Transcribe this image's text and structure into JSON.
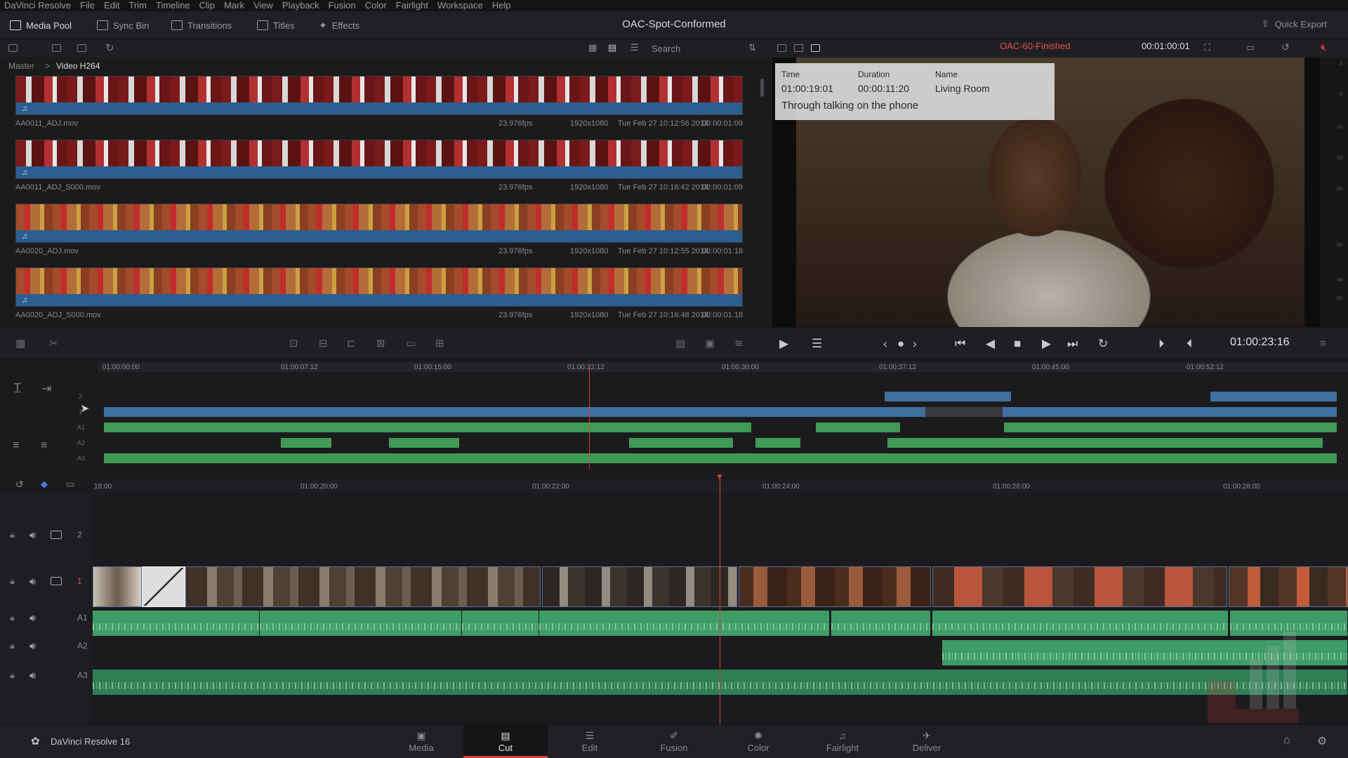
{
  "menu": [
    "DaVinci Resolve",
    "File",
    "Edit",
    "Trim",
    "Timeline",
    "Clip",
    "Mark",
    "View",
    "Playback",
    "Fusion",
    "Color",
    "Fairlight",
    "Workspace",
    "Help"
  ],
  "toolbar": {
    "media_pool": "Media Pool",
    "sync_bin": "Sync Bin",
    "transitions": "Transitions",
    "titles": "Titles",
    "effects": "Effects",
    "project_title": "OAC-Spot-Conformed",
    "quick_export": "Quick Export"
  },
  "mediapool": {
    "search_placeholder": "Search",
    "breadcrumb": {
      "root": "Master",
      "sep": ">",
      "current": "Video H264"
    },
    "clips": [
      {
        "name": "AA0011_ADJ.mov",
        "fps": "23.976fps",
        "res": "1920x1080",
        "date": "Tue Feb 27 10:12:56 2018",
        "duration": "00:00:01:09",
        "film": "red"
      },
      {
        "name": "AA0011_ADJ_S000.mov",
        "fps": "23.976fps",
        "res": "1920x1080",
        "date": "Tue Feb 27 10:16:42 2018",
        "duration": "00:00:01:09",
        "film": "red"
      },
      {
        "name": "AA0020_ADJ.mov",
        "fps": "23.976fps",
        "res": "1920x1080",
        "date": "Tue Feb 27 10:12:55 2018",
        "duration": "00:00:01:18",
        "film": "court"
      },
      {
        "name": "AA0020_ADJ_S000.mov",
        "fps": "23.976fps",
        "res": "1920x1080",
        "date": "Tue Feb 27 10:16:48 2018",
        "duration": "00:00:01:18",
        "film": "court"
      }
    ]
  },
  "viewer": {
    "clip_name": "OAC-60-Finished",
    "timecode_top": "00:01:00:01",
    "overlay": {
      "time_label": "Time",
      "time_value": "01:00:19:01",
      "duration_label": "Duration",
      "duration_value": "00:00:11:20",
      "name_label": "Name",
      "name_value": "Living Room",
      "description": "Through talking on the phone"
    },
    "meter_labels": [
      "0",
      "-5",
      "-10",
      "-15",
      "-20",
      "-30",
      "-40",
      "-50"
    ]
  },
  "transport": {
    "timecode": "01:00:23:16"
  },
  "upper_timeline": {
    "ruler": [
      "01:00:00:00",
      "01:00:07:12",
      "01:00:15:00",
      "01:00:22:12",
      "01:00:30:00",
      "01:00:37:12",
      "01:00:45:00",
      "01:00:52:12"
    ],
    "track_labels": [
      "2",
      "1",
      "A1",
      "A2",
      "A3"
    ]
  },
  "lower_timeline": {
    "ruler": [
      "18:00",
      "01:00:20:00",
      "01:00:22:00",
      "01:00:24:00",
      "01:00:26:00",
      "01:00:28:00"
    ],
    "tracks": [
      {
        "name": "2",
        "type": "video"
      },
      {
        "name": "1",
        "type": "video"
      },
      {
        "name": "A1",
        "type": "audio"
      },
      {
        "name": "A2",
        "type": "audio"
      },
      {
        "name": "A3",
        "type": "audio"
      }
    ]
  },
  "pages": {
    "app_name": "DaVinci Resolve 16",
    "tabs": [
      "Media",
      "Cut",
      "Edit",
      "Fusion",
      "Color",
      "Fairlight",
      "Deliver"
    ],
    "active": "Cut"
  },
  "colors": {
    "accent": "#d4403a",
    "video_track": "#3f6f9f",
    "audio_track": "#3f9a55"
  }
}
